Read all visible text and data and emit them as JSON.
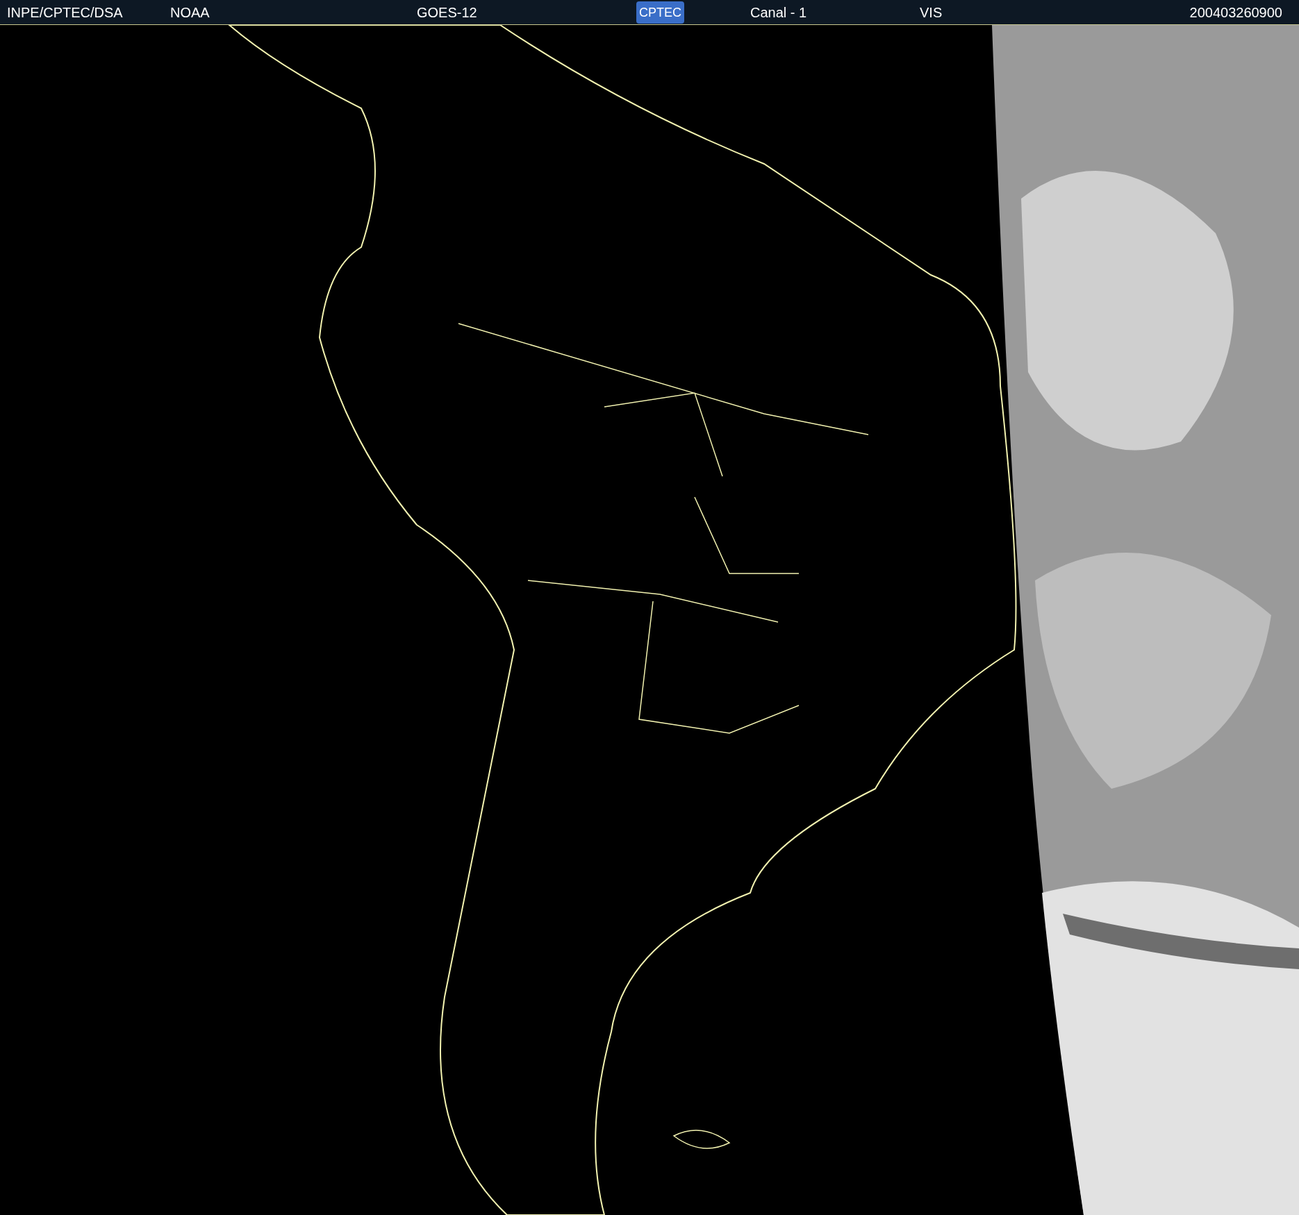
{
  "header": {
    "source": "INPE/CPTEC/DSA",
    "agency": "NOAA",
    "satellite": "GOES-12",
    "logo": "CPTEC",
    "channel": "Canal - 1",
    "band": "VIS",
    "timestamp": "200403260900"
  }
}
